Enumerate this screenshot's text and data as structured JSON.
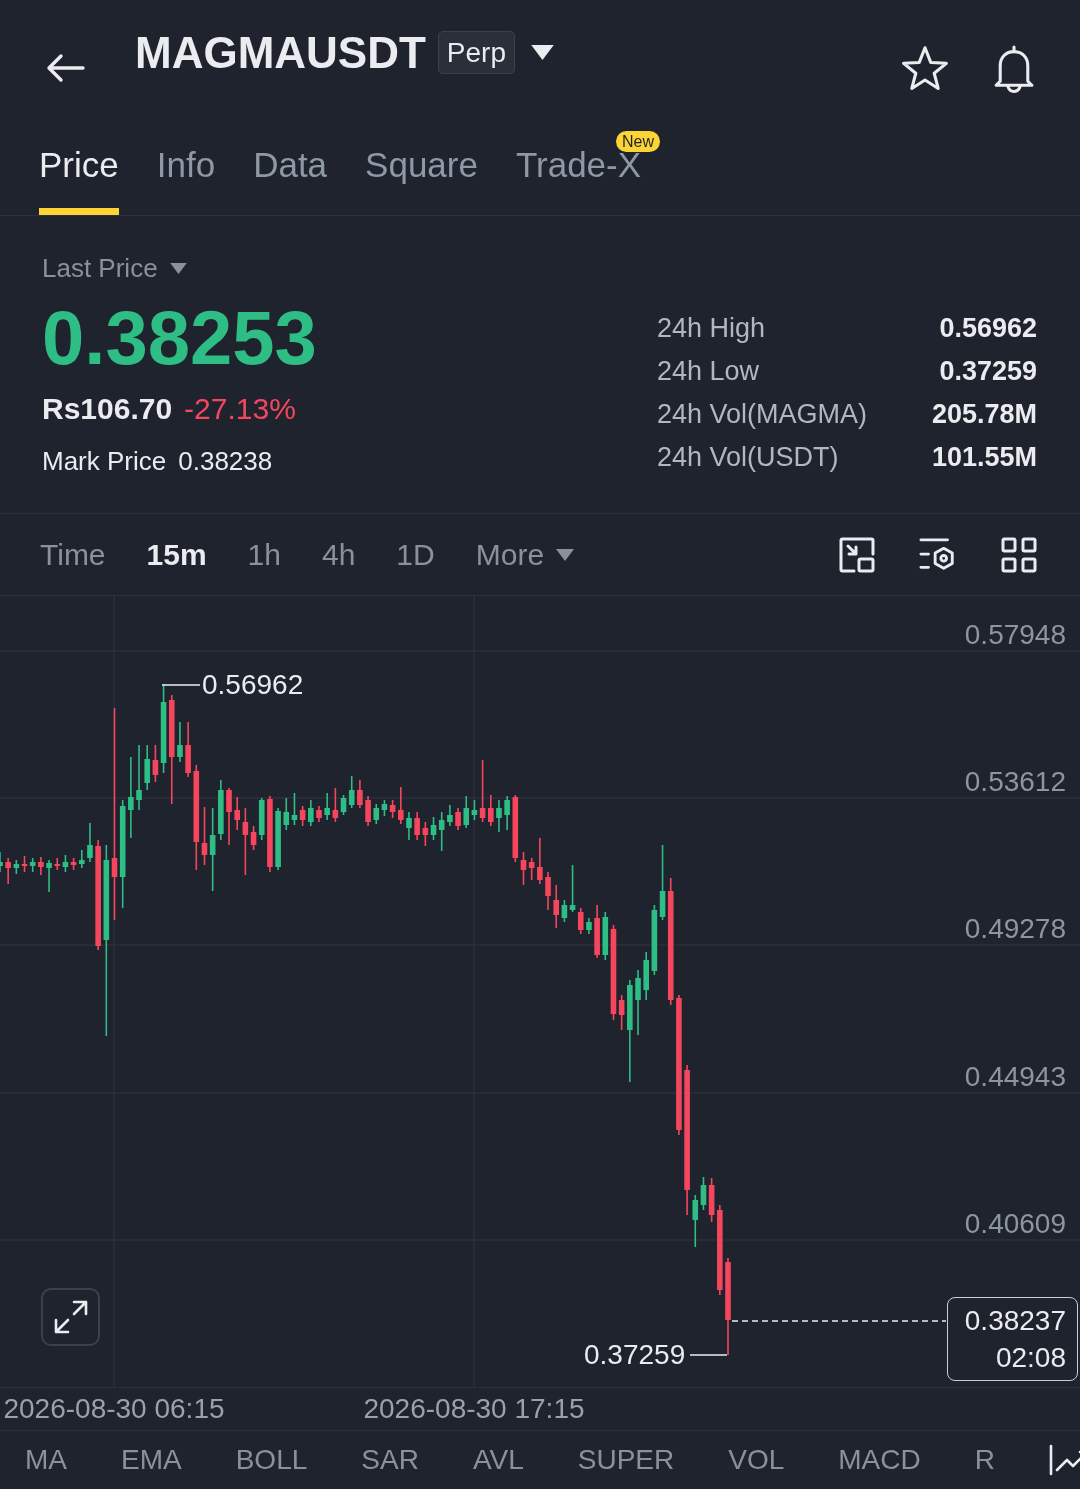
{
  "header": {
    "title": "MAGMAUSDT",
    "badge": "Perp",
    "starred": false
  },
  "tabs": [
    {
      "label": "Price",
      "selected": true
    },
    {
      "label": "Info",
      "selected": false
    },
    {
      "label": "Data",
      "selected": false
    },
    {
      "label": "Square",
      "selected": false
    },
    {
      "label": "Trade-X",
      "selected": false,
      "badge": "New"
    }
  ],
  "ticker": {
    "price_type": "Last Price",
    "last_price": "0.38253",
    "local_price": "Rs106.70",
    "change": "-27.13%",
    "mark_price_label": "Mark Price",
    "mark_price": "0.38238"
  },
  "stats": [
    {
      "label": "24h High",
      "value": "0.56962"
    },
    {
      "label": "24h Low",
      "value": "0.37259"
    },
    {
      "label": "24h Vol(MAGMA)",
      "value": "205.78M"
    },
    {
      "label": "24h Vol(USDT)",
      "value": "101.55M"
    }
  ],
  "intervals": [
    {
      "label": "Time",
      "kind": "option",
      "selected": false
    },
    {
      "label": "15m",
      "kind": "option",
      "selected": true
    },
    {
      "label": "1h",
      "kind": "option",
      "selected": false
    },
    {
      "label": "4h",
      "kind": "option",
      "selected": false
    },
    {
      "label": "1D",
      "kind": "option",
      "selected": false
    },
    {
      "label": "More",
      "kind": "menu",
      "selected": false
    }
  ],
  "chart": {
    "price_axis": [
      "0.57948",
      "0.53612",
      "0.49278",
      "0.44943",
      "0.40609"
    ],
    "time_axis": [
      "2026-08-30 06:15",
      "2026-08-30 17:15"
    ],
    "high_label": "0.56962",
    "low_label": "0.37259",
    "current_price": "0.38237",
    "countdown": "02:08"
  },
  "main_indicators": [
    "MA",
    "EMA",
    "BOLL",
    "SAR",
    "AVL",
    "SUPER"
  ],
  "sub_indicators": [
    "VOL",
    "MACD",
    "R"
  ]
}
